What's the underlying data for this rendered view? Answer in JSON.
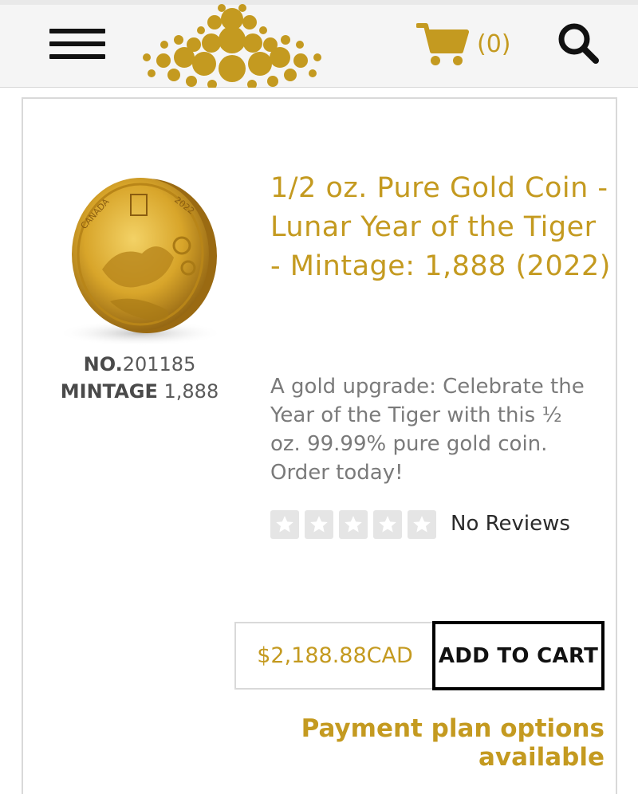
{
  "header": {
    "cart_count": "(0)",
    "brand_color": "#c49a20",
    "icons": [
      "menu-icon",
      "logo-dots",
      "cart-icon",
      "search-icon"
    ]
  },
  "product": {
    "title": "1/2 oz. Pure Gold Coin - Lunar Year of the Tiger - Mintage: 1,888 (2022)",
    "number_label": "NO.",
    "number_value": "201185",
    "mintage_label": "MINTAGE",
    "mintage_value": "1,888",
    "description": "A gold upgrade: Celebrate the Year of the Tiger with this ½ oz. 99.99% pure gold coin. Order today!",
    "rating": {
      "stars_filled": 0,
      "stars_total": 5,
      "reviews_text": "No Reviews"
    },
    "price": "$2,188.88CAD",
    "add_to_cart_label": "ADD TO CART",
    "payment_plan_text": "Payment plan options available",
    "coin_inscriptions": {
      "country": "CANADA",
      "year": "2022"
    }
  }
}
